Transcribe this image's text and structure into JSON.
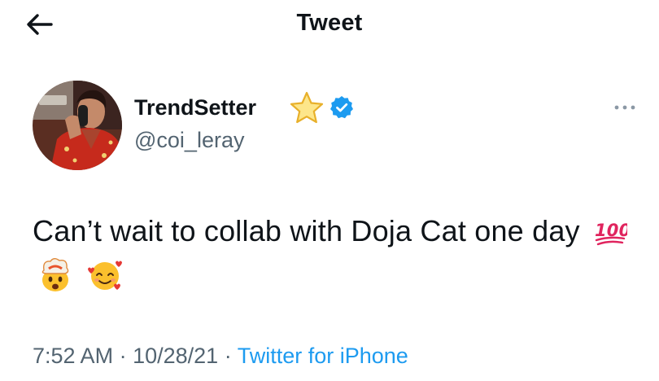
{
  "header": {
    "title": "Tweet",
    "back_icon": "arrow-left-icon"
  },
  "author": {
    "display_name": "TrendSetter",
    "handle": "@coi_leray",
    "name_emoji": "star-icon",
    "verified_icon": "verified-badge-icon",
    "avatar": "profile-photo"
  },
  "tweet": {
    "text": "Can’t wait to collab with Doja Cat one day",
    "emojis": [
      "hundred-points-icon",
      "exploding-head-icon",
      "smiling-face-with-hearts-icon"
    ]
  },
  "meta": {
    "time": "7:52 AM",
    "separator": "·",
    "date": "10/28/21",
    "source": "Twitter for iPhone"
  },
  "colors": {
    "text": "#0f1419",
    "secondary": "#536471",
    "link": "#1d9bf0",
    "verified": "#1d9bf0",
    "emoji_100": "#e0245e"
  }
}
